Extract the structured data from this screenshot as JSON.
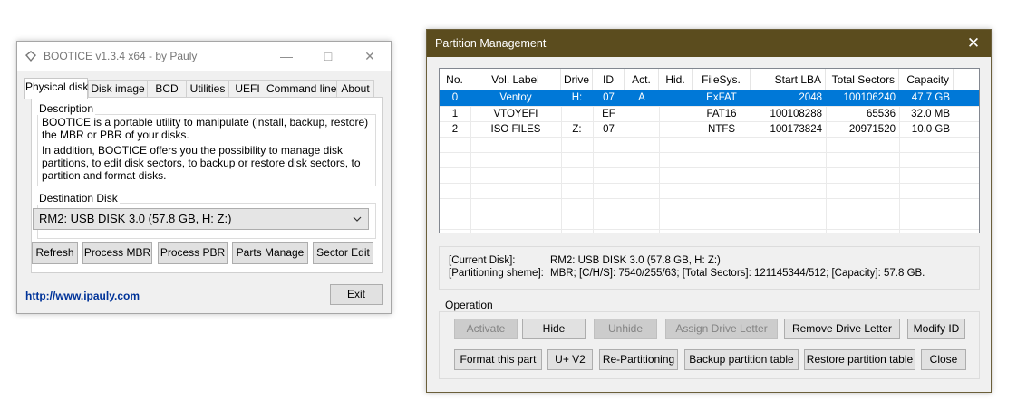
{
  "bootice": {
    "title": "BOOTICE v1.3.4 x64 - by Pauly",
    "tabs": [
      "Physical disk",
      "Disk image",
      "BCD",
      "Utilities",
      "UEFI",
      "Command line",
      "About"
    ],
    "description_label": "Description",
    "description_p1": "BOOTICE is a portable utility to manipulate (install, backup, restore) the MBR or PBR of your disks.",
    "description_p2": "In addition, BOOTICE offers you the possibility to manage disk partitions, to edit disk sectors, to backup or restore disk sectors, to partition and format disks.",
    "destination_label": "Destination Disk",
    "destination_value": "RM2:  USB DISK 3.0 (57.8 GB, H: Z:)",
    "buttons": {
      "refresh": "Refresh",
      "process_mbr": "Process MBR",
      "process_pbr": "Process PBR",
      "parts_manage": "Parts Manage",
      "sector_edit": "Sector Edit",
      "exit": "Exit"
    },
    "link": "http://www.ipauly.com"
  },
  "partition": {
    "title": "Partition Management",
    "columns": [
      "No.",
      "Vol. Label",
      "Drive",
      "ID",
      "Act.",
      "Hid.",
      "FileSys.",
      "Start LBA",
      "Total Sectors",
      "Capacity"
    ],
    "rows": [
      {
        "no": "0",
        "label": "Ventoy",
        "drive": "H:",
        "id": "07",
        "act": "A",
        "hid": "",
        "fs": "ExFAT",
        "start": "2048",
        "total": "100106240",
        "capacity": "47.7 GB",
        "selected": true
      },
      {
        "no": "1",
        "label": "VTOYEFI",
        "drive": "",
        "id": "EF",
        "act": "",
        "hid": "",
        "fs": "FAT16",
        "start": "100108288",
        "total": "65536",
        "capacity": "32.0 MB",
        "selected": false
      },
      {
        "no": "2",
        "label": "ISO FILES",
        "drive": "Z:",
        "id": "07",
        "act": "",
        "hid": "",
        "fs": "NTFS",
        "start": "100173824",
        "total": "20971520",
        "capacity": "10.0 GB",
        "selected": false
      }
    ],
    "current_disk_label": "[Current Disk]:",
    "current_disk_value": "RM2:  USB DISK 3.0 (57.8 GB, H: Z:)",
    "partitioning_label": "[Partitioning sheme]:",
    "partitioning_value": "MBR;     [C/H/S]: 7540/255/63; [Total Sectors]: 121145344/512; [Capacity]: 57.8 GB.",
    "operation_label": "Operation",
    "ops": {
      "activate": "Activate",
      "hide": "Hide",
      "unhide": "Unhide",
      "assign": "Assign Drive Letter",
      "remove": "Remove Drive Letter",
      "modify": "Modify ID",
      "format": "Format this part",
      "uv2": "U+ V2",
      "repartition": "Re-Partitioning",
      "backup": "Backup partition table",
      "restore": "Restore partition table",
      "close": "Close"
    }
  }
}
